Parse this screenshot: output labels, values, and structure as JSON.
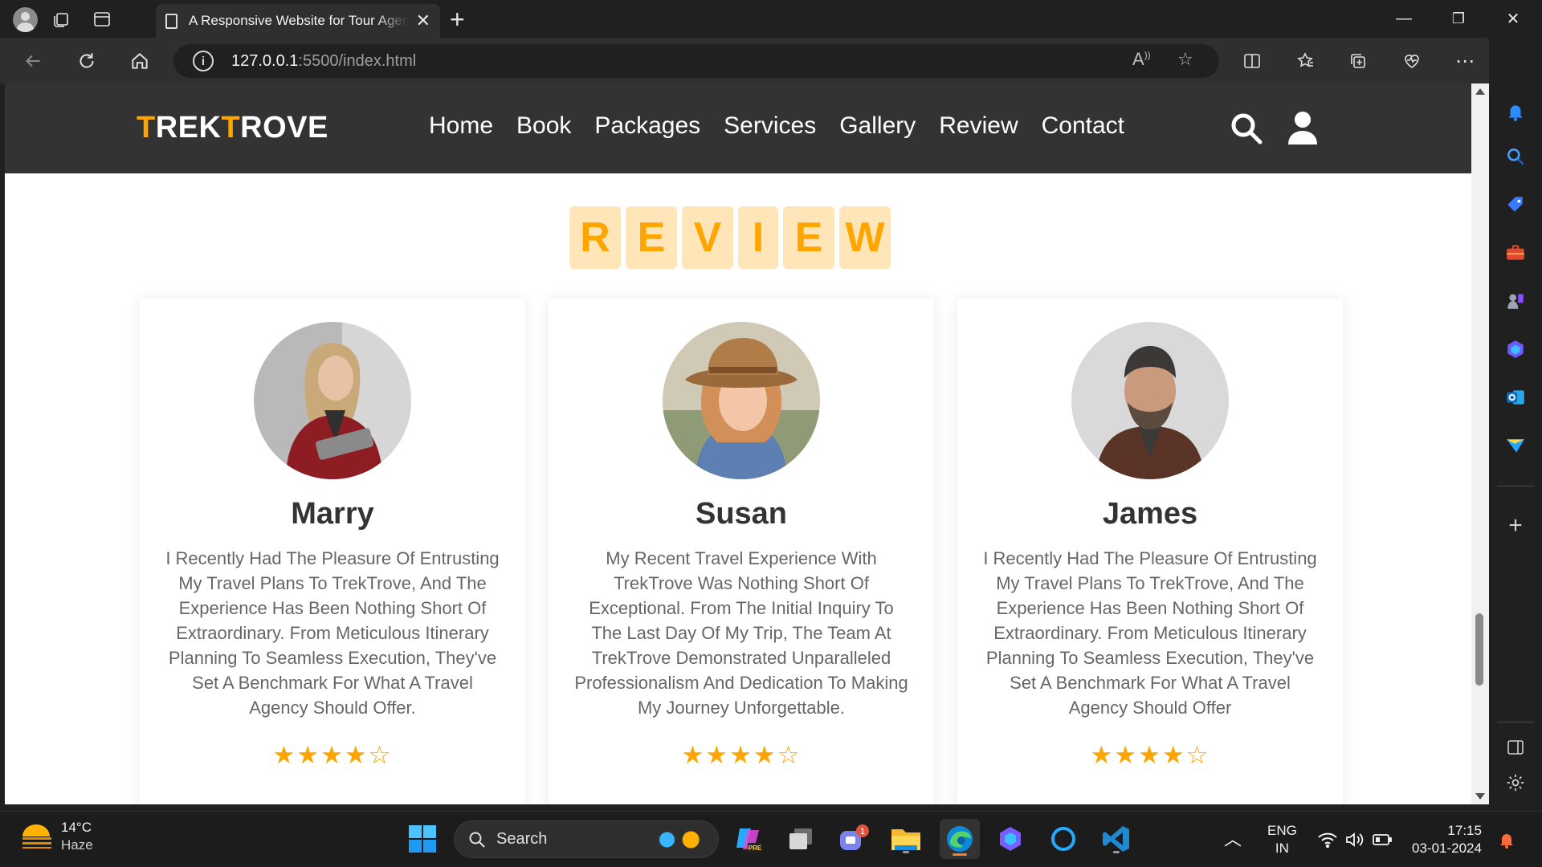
{
  "browser": {
    "tab_title": "A Responsive Website for Tour Agency",
    "new_tab": "+",
    "url_host": "127.0.0.1",
    "url_path": ":5500/index.html",
    "window": {
      "minimize": "—",
      "restore": "❐",
      "close": "✕"
    }
  },
  "site": {
    "logo": {
      "part1": "TREK",
      "t": "T",
      "part2": "ROVE"
    },
    "nav": [
      "Home",
      "Book",
      "Packages",
      "Services",
      "Gallery",
      "Review",
      "Contact"
    ],
    "review_letters": [
      "R",
      "E",
      "V",
      "I",
      "E",
      "W"
    ],
    "reviews": [
      {
        "name": "Marry",
        "text": "I Recently Had The Pleasure Of Entrusting My Travel Plans To TrekTrove, And The Experience Has Been Nothing Short Of Extraordinary. From Meticulous Itinerary Planning To Seamless Execution, They've Set A Benchmark For What A Travel Agency Should Offer.",
        "stars": "★★★★☆",
        "rating": 4
      },
      {
        "name": "Susan",
        "text": "My Recent Travel Experience With TrekTrove Was Nothing Short Of Exceptional. From The Initial Inquiry To The Last Day Of My Trip, The Team At TrekTrove Demonstrated Unparalleled Professionalism And Dedication To Making My Journey Unforgettable.",
        "stars": "★★★★☆",
        "rating": 4
      },
      {
        "name": "James",
        "text": "I Recently Had The Pleasure Of Entrusting My Travel Plans To TrekTrove, And The Experience Has Been Nothing Short Of Extraordinary. From Meticulous Itinerary Planning To Seamless Execution, They've Set A Benchmark For What A Travel Agency Should Offer",
        "stars": "★★★★☆",
        "rating": 4
      }
    ],
    "colors": {
      "accent": "#ffa500",
      "header_bg": "#333333",
      "tile_bg": "#ffe5b8"
    }
  },
  "taskbar": {
    "weather_temp": "14°C",
    "weather_desc": "Haze",
    "search_label": "Search",
    "teams_badge": "1",
    "lang_line1": "ENG",
    "lang_line2": "IN",
    "time": "17:15",
    "date": "03-01-2024"
  }
}
